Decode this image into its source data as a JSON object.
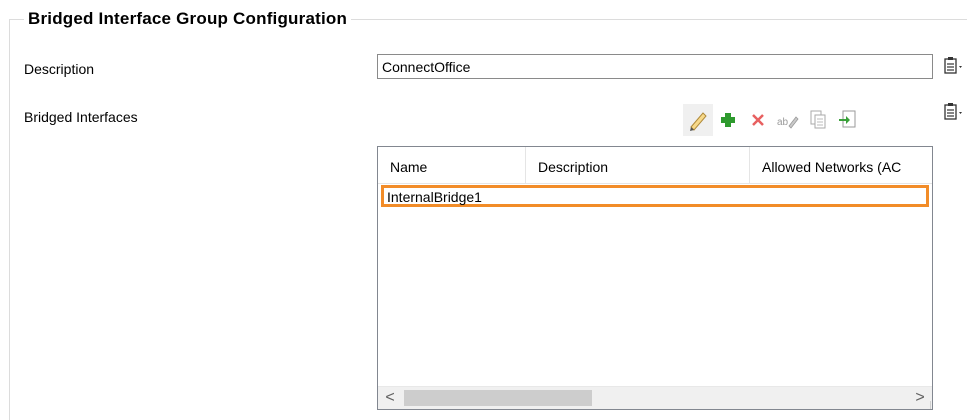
{
  "group": {
    "title": "Bridged Interface Group Configuration"
  },
  "description": {
    "label": "Description",
    "value": "ConnectOffice"
  },
  "bridged": {
    "label": "Bridged Interfaces",
    "toolbar": [
      "edit-icon",
      "add-icon",
      "delete-icon",
      "rename-icon",
      "copy-icon",
      "import-icon"
    ],
    "columns": [
      "Name",
      "Description",
      "Allowed Networks (AC"
    ],
    "rows": [
      {
        "name": "InternalBridge1",
        "description": "",
        "allowed": ""
      }
    ]
  },
  "scrollbar": {
    "left": "<",
    "right": ">"
  },
  "colors": {
    "selection_border": "#f28c28",
    "add_green": "#2e9a2e",
    "delete_red": "#e03a3a"
  }
}
